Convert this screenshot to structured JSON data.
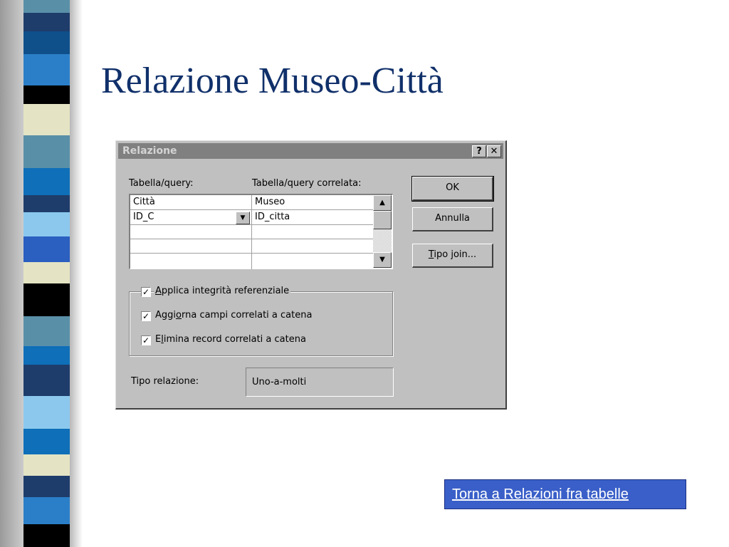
{
  "slide": {
    "title": "Relazione Museo-Città",
    "colors": {
      "title": "#10306a",
      "link_bg": "#3a5fc8"
    },
    "link": "Torna a Relazioni fra tabelle"
  },
  "dialog": {
    "title": "Relazione",
    "help_icon": "?",
    "close_icon": "✕",
    "table_label": "Tabella/query:",
    "related_label": "Tabella/query correlata:",
    "grid": {
      "left_header": "Città",
      "right_header": "Museo",
      "rows": [
        {
          "left": "ID_C",
          "right": "ID_citta"
        }
      ]
    },
    "buttons": {
      "ok": "OK",
      "cancel": "Annulla",
      "join_prefix": "T",
      "join_rest": "ipo join..."
    },
    "checkboxes": {
      "integrity": {
        "accel": "A",
        "rest": "pplica integrità referenziale",
        "checked": true
      },
      "cascade_update": {
        "pre": "Aggi",
        "accel": "o",
        "rest": "rna campi correlati a catena",
        "checked": true
      },
      "cascade_delete": {
        "pre": "E",
        "accel": "l",
        "rest": "imina record correlati a catena",
        "checked": true
      }
    },
    "relation_label": "Tipo relazione:",
    "relation_value": "Uno-a-molti"
  }
}
